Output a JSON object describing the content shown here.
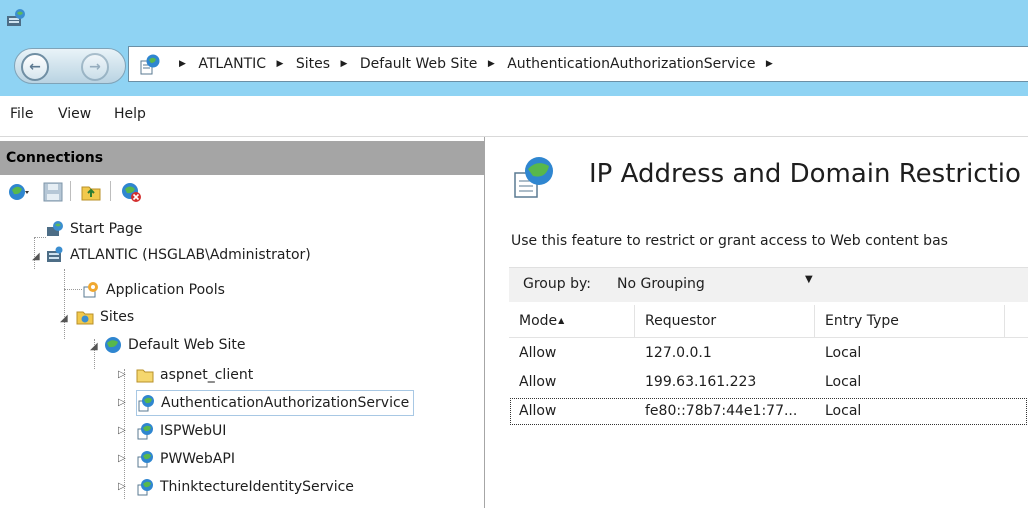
{
  "window": {
    "icon": "iis-manager-icon"
  },
  "nav": {
    "back_glyph": "←",
    "forward_glyph": "→",
    "breadcrumb": [
      "ATLANTIC",
      "Sites",
      "Default Web Site",
      "AuthenticationAuthorizationService"
    ],
    "separator": "▶"
  },
  "menu": {
    "items": [
      "File",
      "View",
      "Help"
    ]
  },
  "connections": {
    "header": "Connections",
    "tree": [
      {
        "label": "Start Page",
        "icon": "start-page-icon"
      },
      {
        "label": "ATLANTIC (HSGLAB\\Administrator)",
        "icon": "server-icon"
      },
      {
        "label": "Application Pools",
        "icon": "app-pools-icon"
      },
      {
        "label": "Sites",
        "icon": "sites-folder-icon"
      },
      {
        "label": "Default Web Site",
        "icon": "globe-site-icon"
      },
      {
        "label": "aspnet_client",
        "icon": "folder-icon"
      },
      {
        "label": "AuthenticationAuthorizationService",
        "icon": "web-app-icon"
      },
      {
        "label": "ISPWebUI",
        "icon": "web-app-icon"
      },
      {
        "label": "PWWebAPI",
        "icon": "web-app-icon"
      },
      {
        "label": "ThinktectureIdentityService",
        "icon": "web-app-icon"
      }
    ]
  },
  "feature": {
    "title": "IP Address and Domain Restrictio",
    "description": "Use this feature to restrict or grant access to Web content bas",
    "group_by_label": "Group by:",
    "group_by_value": "No Grouping",
    "columns": [
      "Mode",
      "Requestor",
      "Entry Type"
    ],
    "rows": [
      {
        "mode": "Allow",
        "requestor": "127.0.0.1",
        "entry_type": "Local"
      },
      {
        "mode": "Allow",
        "requestor": "199.63.161.223",
        "entry_type": "Local"
      },
      {
        "mode": "Allow",
        "requestor": "fe80::78b7:44e1:77...",
        "entry_type": "Local"
      }
    ]
  },
  "colors": {
    "chrome": "#8fd3f3",
    "panel_header": "#a5a5a5",
    "group_bar": "#f1f1f1"
  }
}
